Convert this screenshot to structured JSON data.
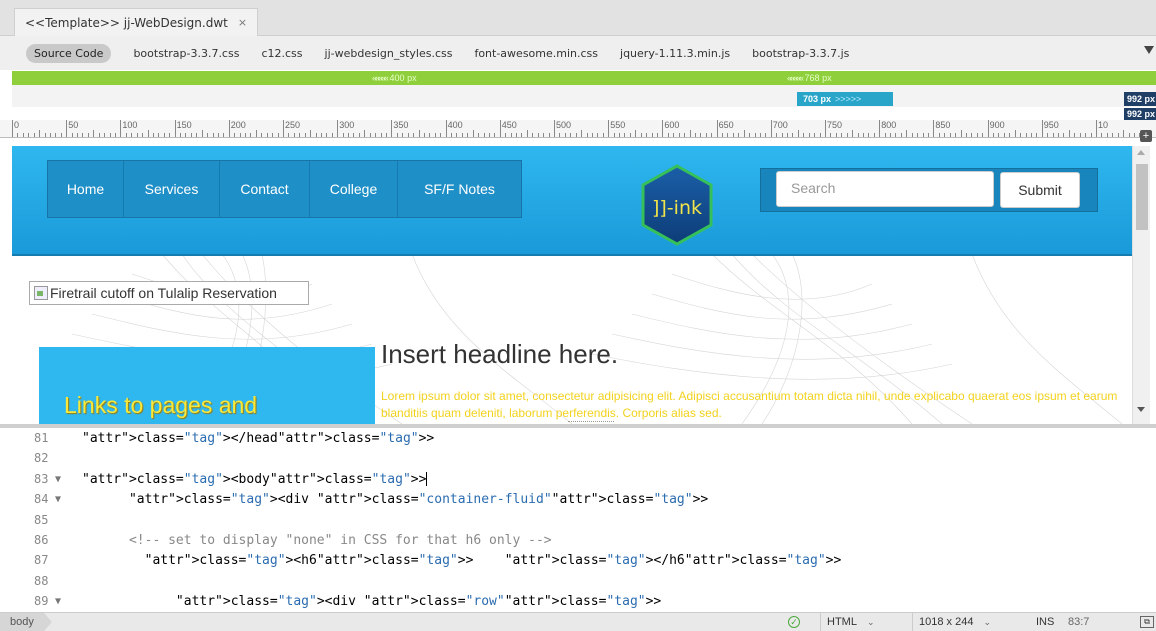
{
  "document_tab": {
    "title": "<<Template>> jj-WebDesign.dwt",
    "close": "×"
  },
  "related_files": [
    "Source Code",
    "bootstrap-3.3.7.css",
    "c12.css",
    "jj-webdesign_styles.css",
    "font-awesome.min.css",
    "jquery-1.11.3.min.js",
    "bootstrap-3.3.7.js"
  ],
  "media_queries": {
    "green_left": "400  px",
    "green_right": "768  px",
    "blue_min": "703  px",
    "blue_arrows": ">>>>>",
    "max1": "992  px",
    "max2": "992  px"
  },
  "ruler_labels": [
    "0",
    "50",
    "100",
    "150",
    "200",
    "250",
    "300",
    "350",
    "400",
    "450",
    "500",
    "550",
    "600",
    "650",
    "700",
    "750",
    "800",
    "850",
    "900",
    "950",
    "10"
  ],
  "design": {
    "nav_items": [
      "Home",
      "Services",
      "Contact",
      "College",
      "SF/F Notes"
    ],
    "logo_text": "]]-ink",
    "search_placeholder": "Search",
    "submit_label": "Submit",
    "broken_image_alt": "Firetrail cutoff on Tulalip Reservation",
    "sidebar_title": "Links to pages and",
    "headline": "Insert headline here.",
    "lorem": "Lorem ipsum dolor sit amet, consectetur adipisicing elit. Adipisci accusantium totam dicta nihil, unde explicabo quaerat eos ipsum et earum blanditiis quam deleniti, laborum perferendis. Corporis alias sed."
  },
  "code_lines": [
    {
      "num": "81",
      "fold": "",
      "html": "</head>"
    },
    {
      "num": "82",
      "fold": "",
      "html": ""
    },
    {
      "num": "83",
      "fold": "▼",
      "html": "<body>"
    },
    {
      "num": "84",
      "fold": "▼",
      "html": "      <div class=\"container-fluid\">"
    },
    {
      "num": "85",
      "fold": "",
      "html": ""
    },
    {
      "num": "86",
      "fold": "",
      "html": "      <!-- set to display \"none\" in CSS for that h6 only -->"
    },
    {
      "num": "87",
      "fold": "",
      "html": "        <h6>    </h6>"
    },
    {
      "num": "88",
      "fold": "",
      "html": ""
    },
    {
      "num": "89",
      "fold": "▼",
      "html": "            <div class=\"row\">"
    }
  ],
  "status": {
    "breadcrumb": "body",
    "ok": "✓",
    "doc_type": "HTML",
    "window_size": "1018 x 244",
    "mode": "INS",
    "position": "83:7",
    "dropdown": "⌄"
  },
  "colors": {
    "nav_blue": "#2fb7ef",
    "green_mq": "#8fcf3c",
    "blue_mq": "#28a5c8",
    "navy_mq": "#1f3f66",
    "yellow_text": "#f7e83a"
  }
}
